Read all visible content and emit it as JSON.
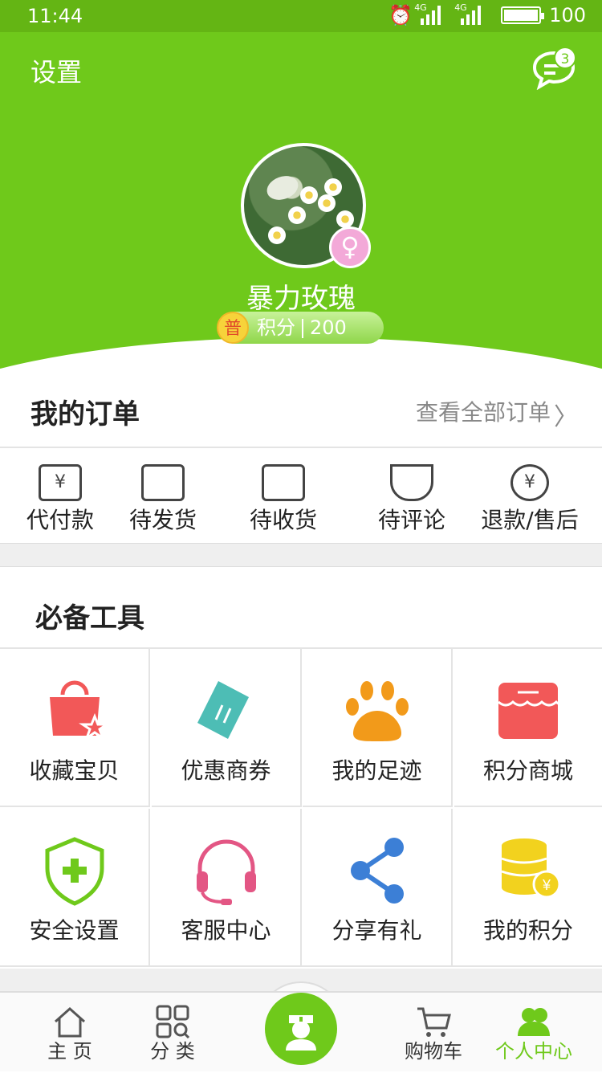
{
  "status_bar": {
    "time": "11:44",
    "network1": "4G",
    "network2": "4G",
    "battery": "100"
  },
  "header": {
    "settings_label": "设置",
    "message_badge": "3",
    "username": "暴力玫瑰",
    "level_badge": "普",
    "points_label": "积分",
    "points_value": "200",
    "gender_symbol": "♀"
  },
  "orders": {
    "title": "我的订单",
    "view_all": "查看全部订单",
    "items": [
      {
        "label": "代付款",
        "icon": "payment-icon"
      },
      {
        "label": "待发货",
        "icon": "package-icon"
      },
      {
        "label": "待收货",
        "icon": "truck-icon"
      },
      {
        "label": "待评论",
        "icon": "tulip-icon"
      },
      {
        "label": "退款/售后",
        "icon": "refund-icon"
      }
    ]
  },
  "tools": {
    "title": "必备工具",
    "items": [
      {
        "label": "收藏宝贝",
        "icon": "favorite-bag-icon"
      },
      {
        "label": "优惠商券",
        "icon": "coupon-icon"
      },
      {
        "label": "我的足迹",
        "icon": "paw-icon"
      },
      {
        "label": "积分商城",
        "icon": "store-icon"
      },
      {
        "label": "安全设置",
        "icon": "shield-icon"
      },
      {
        "label": "客服中心",
        "icon": "headset-icon"
      },
      {
        "label": "分享有礼",
        "icon": "share-icon"
      },
      {
        "label": "我的积分",
        "icon": "coins-icon"
      }
    ]
  },
  "tabbar": {
    "home": "主 页",
    "category": "分 类",
    "cart": "购物车",
    "profile": "个人中心",
    "active_color": "#6fc91b"
  },
  "colors": {
    "brand": "#6fc91b",
    "status_bar": "#64b514"
  }
}
